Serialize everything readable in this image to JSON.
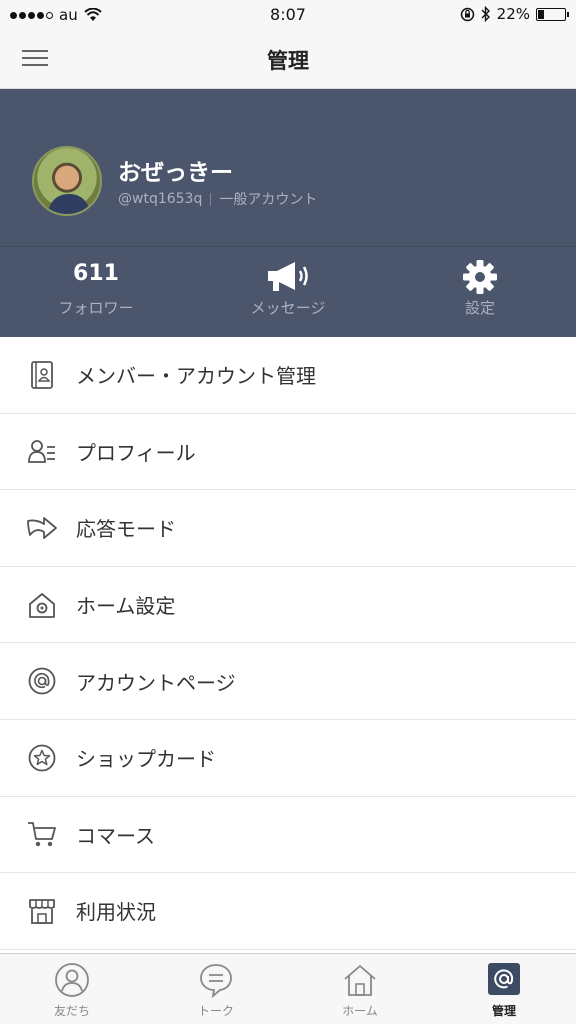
{
  "status_bar": {
    "carrier": "au",
    "time": "8:07",
    "battery_percent": "22%",
    "battery_level": 0.22
  },
  "nav": {
    "title": "管理"
  },
  "profile": {
    "name": "おぜっきー",
    "handle": "@wtq1653q",
    "account_type": "一般アカウント"
  },
  "stats": [
    {
      "value": "611",
      "label": "フォロワー",
      "icon": "none"
    },
    {
      "label": "メッセージ",
      "icon": "megaphone-icon"
    },
    {
      "label": "設定",
      "icon": "gear-icon"
    }
  ],
  "menu": [
    {
      "label": "メンバー・アカウント管理",
      "icon": "member-book-icon"
    },
    {
      "label": "プロフィール",
      "icon": "profile-card-icon"
    },
    {
      "label": "応答モード",
      "icon": "reply-arrow-icon"
    },
    {
      "label": "ホーム設定",
      "icon": "home-gear-icon"
    },
    {
      "label": "アカウントページ",
      "icon": "at-circle-icon"
    },
    {
      "label": "ショップカード",
      "icon": "star-circle-icon"
    },
    {
      "label": "コマース",
      "icon": "cart-icon"
    },
    {
      "label": "利用状況",
      "icon": "storefront-icon"
    }
  ],
  "tabs": [
    {
      "label": "友だち",
      "icon": "person-icon",
      "active": false
    },
    {
      "label": "トーク",
      "icon": "chat-bubble-icon",
      "active": false
    },
    {
      "label": "ホーム",
      "icon": "house-icon",
      "active": false
    },
    {
      "label": "管理",
      "icon": "at-square-icon",
      "active": true
    }
  ],
  "colors": {
    "header_bg": "#4b566d",
    "bar_bg": "#f7f7f7",
    "active_tab": "#3d4a63"
  }
}
